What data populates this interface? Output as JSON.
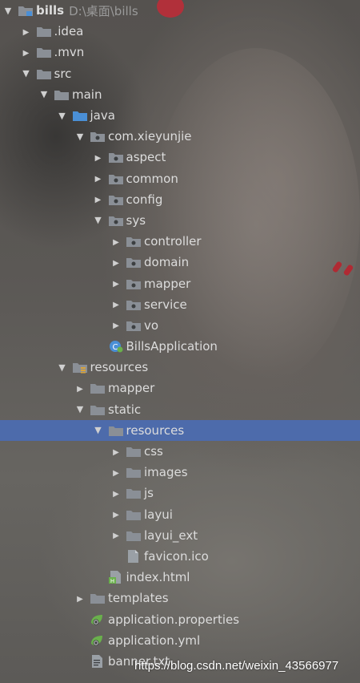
{
  "project_tree": {
    "root": {
      "label": "bills",
      "path": "D:\\桌面\\bills"
    },
    "items": [
      {
        "label": "bills",
        "depth": 0,
        "state": "expanded",
        "icon": "module-folder-icon"
      },
      {
        "label": ".idea",
        "depth": 1,
        "state": "collapsed",
        "icon": "folder-icon"
      },
      {
        "label": ".mvn",
        "depth": 1,
        "state": "collapsed",
        "icon": "folder-icon"
      },
      {
        "label": "src",
        "depth": 1,
        "state": "expanded",
        "icon": "folder-icon"
      },
      {
        "label": "main",
        "depth": 2,
        "state": "expanded",
        "icon": "folder-icon"
      },
      {
        "label": "java",
        "depth": 3,
        "state": "expanded",
        "icon": "source-folder-icon"
      },
      {
        "label": "com.xieyunjie",
        "depth": 4,
        "state": "expanded",
        "icon": "package-icon"
      },
      {
        "label": "aspect",
        "depth": 5,
        "state": "collapsed",
        "icon": "package-icon"
      },
      {
        "label": "common",
        "depth": 5,
        "state": "collapsed",
        "icon": "package-icon"
      },
      {
        "label": "config",
        "depth": 5,
        "state": "collapsed",
        "icon": "package-icon"
      },
      {
        "label": "sys",
        "depth": 5,
        "state": "expanded",
        "icon": "package-icon"
      },
      {
        "label": "controller",
        "depth": 6,
        "state": "collapsed",
        "icon": "package-icon"
      },
      {
        "label": "domain",
        "depth": 6,
        "state": "collapsed",
        "icon": "package-icon"
      },
      {
        "label": "mapper",
        "depth": 6,
        "state": "collapsed",
        "icon": "package-icon"
      },
      {
        "label": "service",
        "depth": 6,
        "state": "collapsed",
        "icon": "package-icon"
      },
      {
        "label": "vo",
        "depth": 6,
        "state": "collapsed",
        "icon": "package-icon"
      },
      {
        "label": "BillsApplication",
        "depth": 5,
        "state": "leaf",
        "icon": "spring-boot-class-icon"
      },
      {
        "label": "resources",
        "depth": 3,
        "state": "expanded",
        "icon": "resources-folder-icon"
      },
      {
        "label": "mapper",
        "depth": 4,
        "state": "collapsed",
        "icon": "folder-icon"
      },
      {
        "label": "static",
        "depth": 4,
        "state": "expanded",
        "icon": "folder-icon"
      },
      {
        "label": "resources",
        "depth": 5,
        "state": "expanded",
        "icon": "folder-icon",
        "selected": true
      },
      {
        "label": "css",
        "depth": 6,
        "state": "collapsed",
        "icon": "folder-icon"
      },
      {
        "label": "images",
        "depth": 6,
        "state": "collapsed",
        "icon": "folder-icon"
      },
      {
        "label": "js",
        "depth": 6,
        "state": "collapsed",
        "icon": "folder-icon"
      },
      {
        "label": "layui",
        "depth": 6,
        "state": "collapsed",
        "icon": "folder-icon"
      },
      {
        "label": "layui_ext",
        "depth": 6,
        "state": "collapsed",
        "icon": "folder-icon"
      },
      {
        "label": "favicon.ico",
        "depth": 6,
        "state": "leaf",
        "icon": "file-icon"
      },
      {
        "label": "index.html",
        "depth": 5,
        "state": "leaf",
        "icon": "html-file-icon"
      },
      {
        "label": "templates",
        "depth": 4,
        "state": "collapsed",
        "icon": "folder-icon"
      },
      {
        "label": "application.properties",
        "depth": 4,
        "state": "leaf",
        "icon": "spring-config-icon"
      },
      {
        "label": "application.yml",
        "depth": 4,
        "state": "leaf",
        "icon": "spring-config-icon"
      },
      {
        "label": "banner.txt",
        "depth": 4,
        "state": "leaf",
        "icon": "text-file-icon"
      }
    ]
  },
  "watermark": "https://blog.csdn.net/weixin_43566977",
  "colors": {
    "selection": "#4d6bab",
    "folder": "#8a8f96",
    "source_folder": "#4a8fd6",
    "spring": "#6ab04c",
    "text": "#dcdcdc",
    "path_hint": "#9a9a9a"
  }
}
